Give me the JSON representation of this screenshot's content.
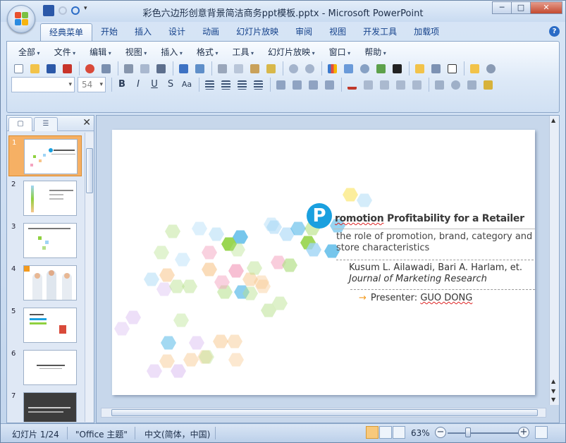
{
  "window": {
    "title": "彩色六边形创意背景简洁商务ppt模板.pptx - Microsoft PowerPoint",
    "controls": {
      "minimize": "─",
      "maximize": "□",
      "close": "✕"
    }
  },
  "ribbon_tabs": [
    {
      "label": "经典菜单",
      "active": true
    },
    {
      "label": "开始"
    },
    {
      "label": "插入"
    },
    {
      "label": "设计"
    },
    {
      "label": "动画"
    },
    {
      "label": "幻灯片放映"
    },
    {
      "label": "审阅"
    },
    {
      "label": "视图"
    },
    {
      "label": "开发工具"
    },
    {
      "label": "加载项"
    }
  ],
  "classic_menu": [
    "全部",
    "文件",
    "编辑",
    "视图",
    "插入",
    "格式",
    "工具",
    "幻灯片放映",
    "窗口",
    "帮助"
  ],
  "font_box": {
    "font": "",
    "size": "54"
  },
  "format_buttons": {
    "bold": "B",
    "italic": "I",
    "underline": "U",
    "shadow": "S",
    "spacing": "Aa"
  },
  "left_pane": {
    "tab_slides": "▢",
    "tab_outline": "☰",
    "close": "✕",
    "slide_numbers": [
      "1",
      "2",
      "3",
      "4",
      "5",
      "6",
      "7"
    ]
  },
  "slide": {
    "title_initial": "P",
    "title_rest": "romotion Profitability for a Retailer",
    "subtitle": "the role of promotion, brand, category and store characteristics",
    "authors": "Kusum L. Ailawadi, Bari A. Harlam, et.",
    "journal": "Journal of Marketing Research",
    "presenter_arrow": "→",
    "presenter_label": "Presenter:",
    "presenter_name": "GUO DONG"
  },
  "status_bar": {
    "slide_counter": "幻灯片 1/24",
    "theme": "\"Office 主题\"",
    "language": "中文(简体，中国)",
    "zoom": "63%",
    "zoom_minus": "−",
    "zoom_plus": "+"
  },
  "colors": {
    "accent_blue": "#1aa0df",
    "thumb_selected": "#f6b064",
    "hex_palette": [
      "#8fd13f",
      "#1aa0df",
      "#f7c58a",
      "#f4a4c0",
      "#b5e08a",
      "#9fd4f5",
      "#d7b8ef",
      "#f9e04d"
    ]
  }
}
